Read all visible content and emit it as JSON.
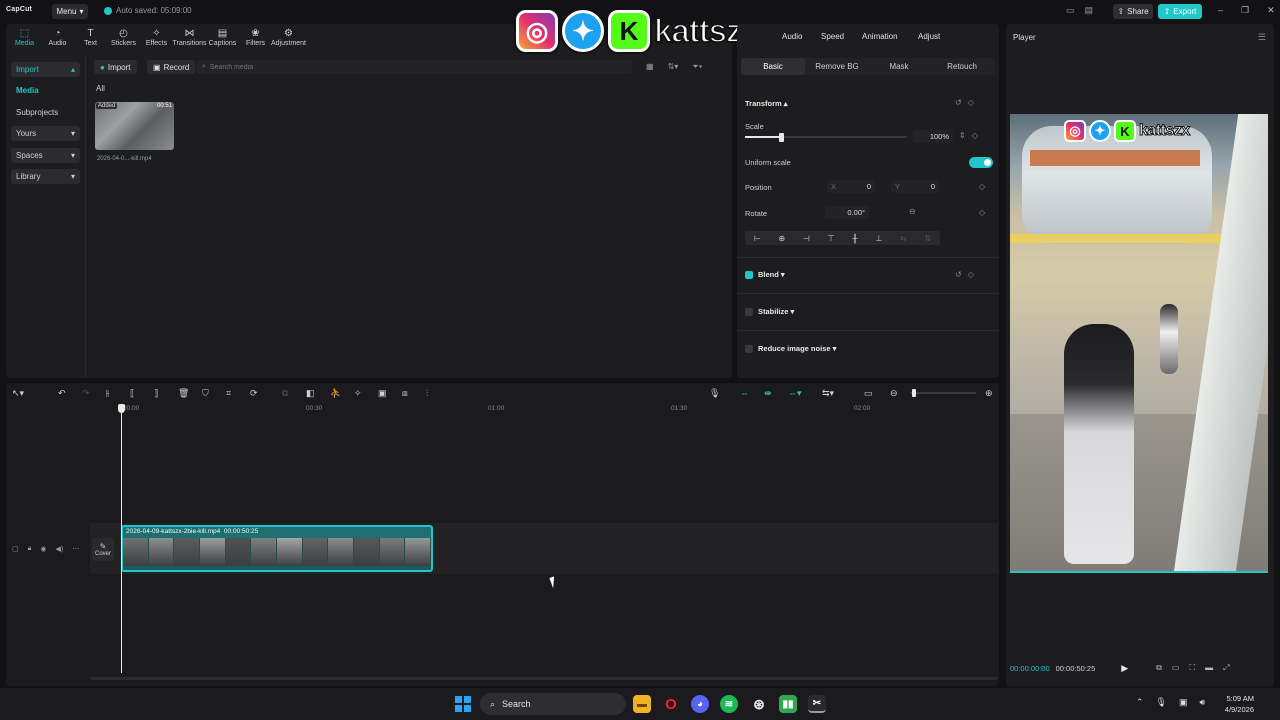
{
  "app": {
    "logo": "CapCut",
    "menu_label": "Menu",
    "autosave": "Auto saved: 05:09:00",
    "share_label": "Share",
    "export_label": "Export"
  },
  "overlay": {
    "watermark_text": "kattszx"
  },
  "tabs": [
    {
      "label": "Media",
      "icon": "media-icon"
    },
    {
      "label": "Audio",
      "icon": "audio-icon"
    },
    {
      "label": "Text",
      "icon": "text-icon"
    },
    {
      "label": "Stickers",
      "icon": "stickers-icon"
    },
    {
      "label": "Effects",
      "icon": "effects-icon"
    },
    {
      "label": "Transitions",
      "icon": "transitions-icon"
    },
    {
      "label": "Captions",
      "icon": "captions-icon"
    },
    {
      "label": "Filters",
      "icon": "filters-icon"
    },
    {
      "label": "Adjustment",
      "icon": "adjustment-icon"
    }
  ],
  "sidenav": {
    "import": "Import",
    "media": "Media",
    "subprojects": "Subprojects",
    "yours": "Yours",
    "spaces": "Spaces",
    "library": "Library"
  },
  "media": {
    "import_label": "Import",
    "record_label": "Record",
    "search_placeholder": "Search media",
    "filter_all": "All",
    "item": {
      "badge": "Added",
      "duration": "00:51",
      "name": "2026-04-0...-kill.mp4"
    }
  },
  "props": {
    "tabs": [
      "Audio",
      "Speed",
      "Animation",
      "Adjust"
    ],
    "subtabs": [
      "Basic",
      "Remove BG",
      "Mask",
      "Retouch"
    ],
    "transform": "Transform",
    "scale_label": "Scale",
    "scale_value": "100%",
    "scale_level": 0.22,
    "uniform_scale": "Uniform scale",
    "position_label": "Position",
    "pos_x_label": "X",
    "pos_x": "0",
    "pos_y_label": "Y",
    "pos_y": "0",
    "rotate_label": "Rotate",
    "rotate_value": "0.00°",
    "blend": "Blend",
    "stabilize": "Stabilize",
    "reduce_noise": "Reduce image noise"
  },
  "player": {
    "title": "Player",
    "current_time": "00:00:00:00",
    "total_time": "00:00:50:25"
  },
  "timeline": {
    "ruler": [
      "00:00",
      "00:30",
      "01:00",
      "01:30",
      "02:00"
    ],
    "clip_name": "2026-04-09-kattszx-2bie-kill.mp4",
    "clip_duration": "00:00:50:25",
    "cover_label": "Cover"
  },
  "taskbar": {
    "search_placeholder": "Search",
    "time": "5:09 AM",
    "date": "4/9/2026"
  },
  "colors": {
    "accent": "#22c5c8",
    "panel": "#1d1d1f",
    "background": "#121214"
  }
}
